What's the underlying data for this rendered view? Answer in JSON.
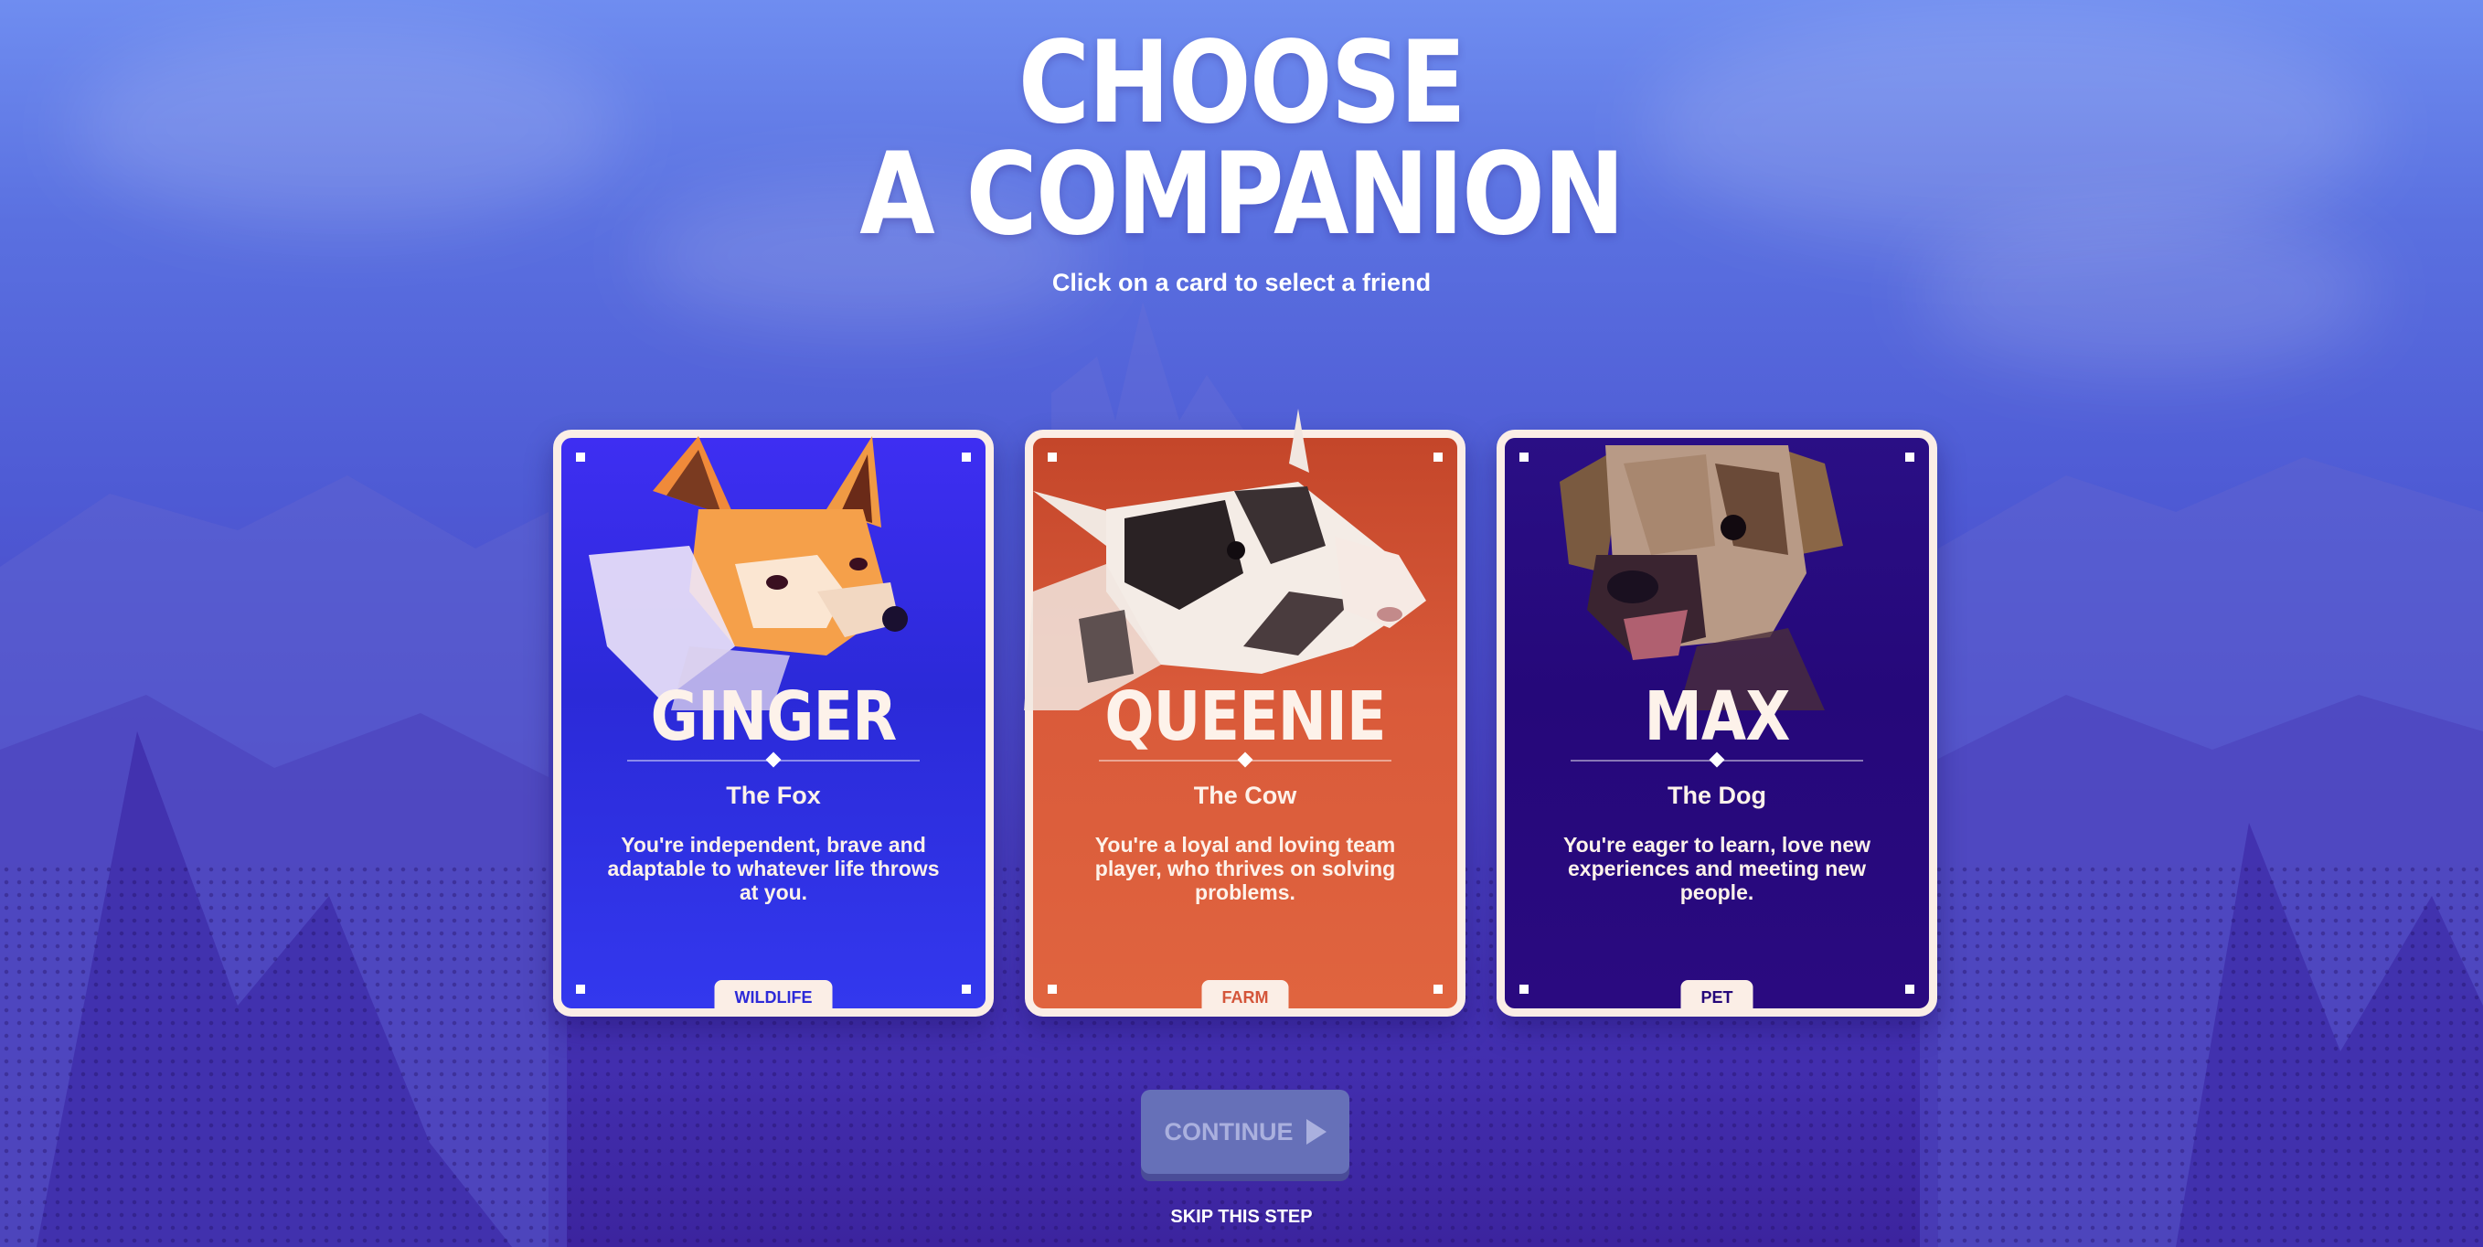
{
  "header": {
    "title_line1": "CHOOSE",
    "title_line2": "A COMPANION",
    "subtitle": "Click on a card to select a friend"
  },
  "cards": [
    {
      "name": "GINGER",
      "species": "The Fox",
      "description": "You're independent, brave and adaptable to whatever life throws at you.",
      "tag": "WILDLIFE",
      "color": "#2d2ad8",
      "icon": "fox-portrait"
    },
    {
      "name": "QUEENIE",
      "species": "The Cow",
      "description": "You're a loyal and loving team player, who thrives on solving problems.",
      "tag": "FARM",
      "color": "#d95a3a",
      "icon": "cow-portrait"
    },
    {
      "name": "MAX",
      "species": "The Dog",
      "description": "You're eager to learn, love new experiences and meeting new people.",
      "tag": "PET",
      "color": "#25087a",
      "icon": "dog-portrait"
    }
  ],
  "actions": {
    "continue_label": "CONTINUE",
    "skip_label": "SKIP THIS STEP"
  },
  "colors": {
    "card_border": "#fbeee6",
    "continue_button": "#6670b8"
  }
}
